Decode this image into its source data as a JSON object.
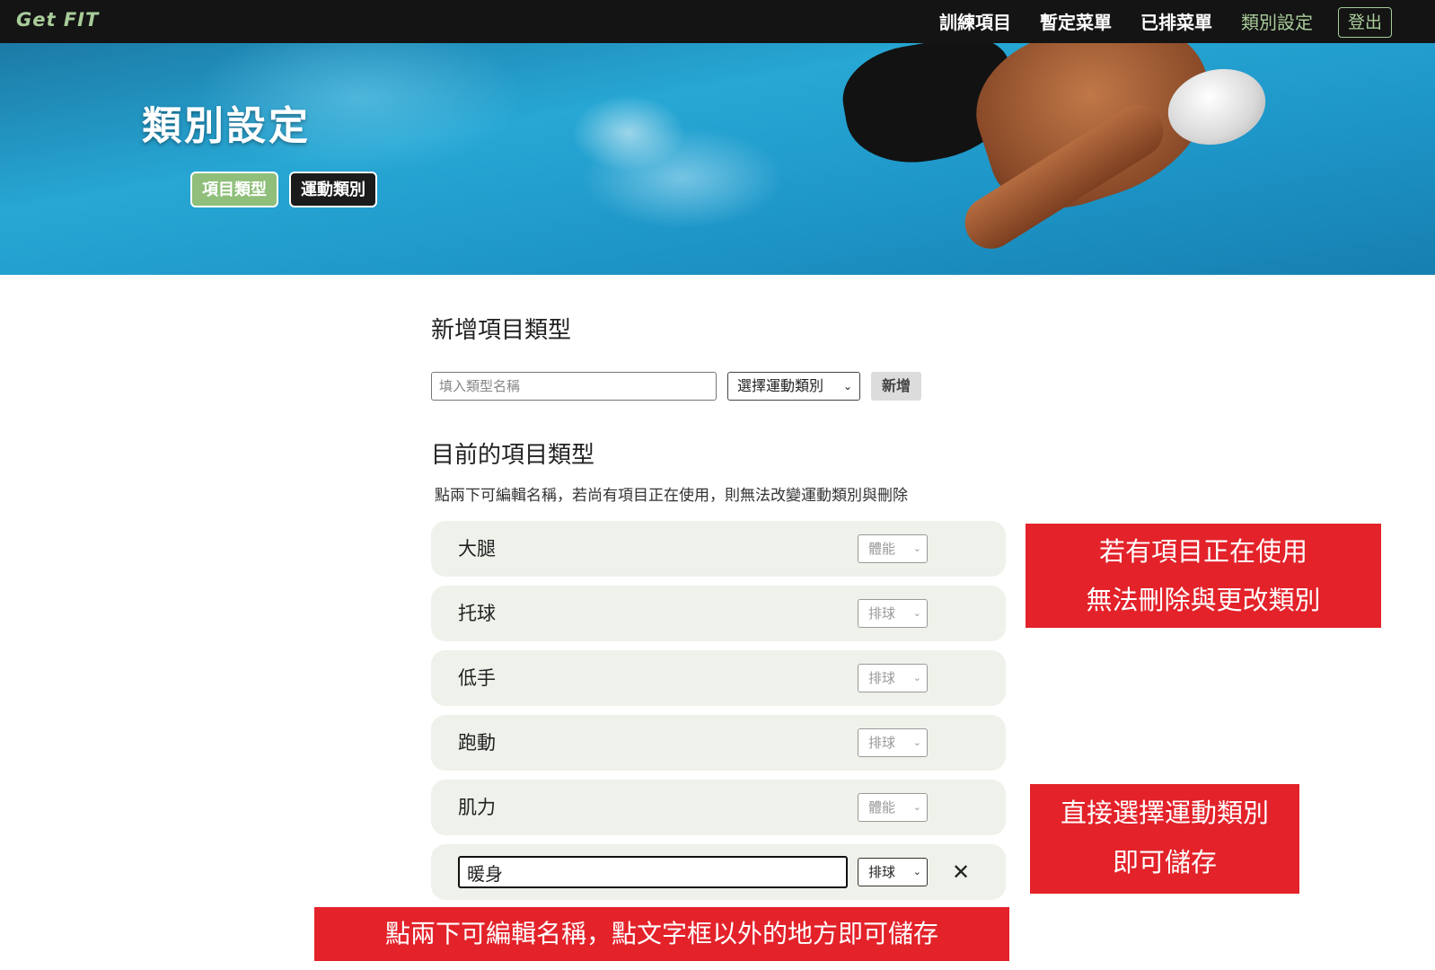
{
  "navbar": {
    "brand": "Get FIT",
    "links": [
      "訓練項目",
      "暫定菜單",
      "已排菜單",
      "類別設定"
    ],
    "logout": "登出"
  },
  "hero": {
    "title": "類別設定",
    "tabs": [
      "項目類型",
      "運動類別"
    ]
  },
  "add_section": {
    "title": "新增項目類型",
    "input_placeholder": "填入類型名稱",
    "select_label": "選擇運動類別",
    "button": "新增"
  },
  "list_section": {
    "title": "目前的項目類型",
    "hint": "點兩下可編輯名稱，若尚有項目正在使用，則無法改變運動類別與刪除",
    "rows": [
      {
        "name": "大腿",
        "category": "體能"
      },
      {
        "name": "托球",
        "category": "排球"
      },
      {
        "name": "低手",
        "category": "排球"
      },
      {
        "name": "跑動",
        "category": "排球"
      },
      {
        "name": "肌力",
        "category": "體能"
      }
    ],
    "editing_row": {
      "value": "暖身",
      "category": "排球"
    }
  },
  "notes": {
    "in_use": [
      "若有項目正在使用",
      "無法刪除與更改類別"
    ],
    "select_save": [
      "直接選擇運動類別",
      "即可儲存"
    ],
    "dblclick_edit": "點兩下可編輯名稱，點文字框以外的地方即可儲存"
  },
  "colors": {
    "accent_green": "#8fbf7a",
    "navbar_bg": "#141414",
    "note_red": "#e3222a",
    "row_bg": "#eef2ea"
  }
}
